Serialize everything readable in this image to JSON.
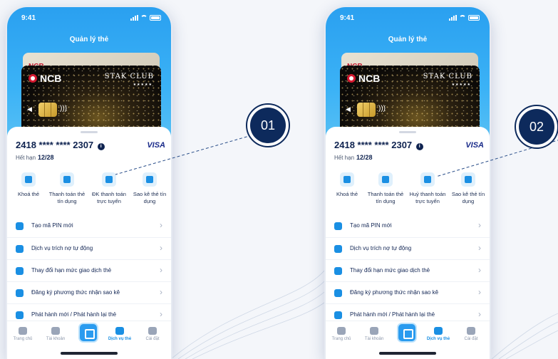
{
  "screens": [
    {
      "status_time": "9:41",
      "title": "Quản lý thẻ",
      "card_back_logo": "NCB",
      "card": {
        "bank": "NCB",
        "brand": "STAK CLUB",
        "stars": "★★★★★"
      },
      "card_number": "2418 **** **** 2307",
      "network": "VISA",
      "expiry_label": "Hết hạn",
      "expiry_value": "12/28",
      "actions": [
        {
          "label": "Khoá thẻ"
        },
        {
          "label": "Thanh toán thẻ tín dụng"
        },
        {
          "label": "ĐK thanh toán trực tuyến"
        },
        {
          "label": "Sao kê thẻ tín dụng"
        }
      ],
      "menu": [
        "Tạo mã PIN mới",
        "Dịch vụ trích nợ tự động",
        "Thay đổi hạn mức giao dịch thẻ",
        "Đăng ký phương thức nhận sao kê",
        "Phát hành mới / Phát hành lại thẻ"
      ],
      "tabs": [
        "Trang chủ",
        "Tài khoản",
        "Dịch vụ thẻ",
        "Cài đặt"
      ],
      "active_tab": "Dịch vụ thẻ",
      "callout": "01"
    },
    {
      "status_time": "9:41",
      "title": "Quản lý thẻ",
      "card_back_logo": "NCB",
      "card": {
        "bank": "NCB",
        "brand": "STAK CLUB",
        "stars": "★★★★★"
      },
      "card_number": "2418 **** **** 2307",
      "network": "VISA",
      "expiry_label": "Hết hạn",
      "expiry_value": "12/28",
      "actions": [
        {
          "label": "Khoá thẻ"
        },
        {
          "label": "Thanh toán thẻ tín dụng"
        },
        {
          "label": "Huỷ thanh toán trực tuyến"
        },
        {
          "label": "Sao kê thẻ tín dụng"
        }
      ],
      "menu": [
        "Tạo mã PIN mới",
        "Dịch vụ trích nợ tự động",
        "Thay đổi hạn mức giao dịch thẻ",
        "Đăng ký phương thức nhận sao kê",
        "Phát hành mới / Phát hành lại thẻ"
      ],
      "tabs": [
        "Trang chủ",
        "Tài khoản",
        "Dịch vụ thẻ",
        "Cài đặt"
      ],
      "active_tab": "Dịch vụ thẻ",
      "callout": "02"
    }
  ],
  "colors": {
    "header": "#2aa0f0",
    "accent": "#1a8fe3",
    "badge": "#0d2a5c"
  }
}
